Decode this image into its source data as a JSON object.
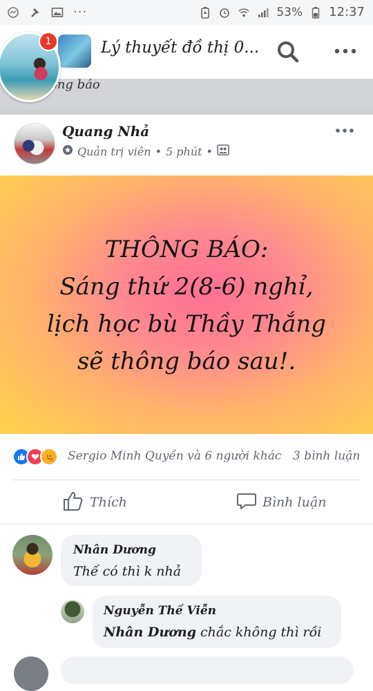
{
  "status_bar": {
    "battery": "53%",
    "time": "12:37",
    "left_icons": [
      "messenger-icon",
      "hammer-icon",
      "image-icon",
      "more-icon"
    ],
    "right_icons": [
      "battery-saver-icon",
      "alarm-icon",
      "wifi-icon",
      "signal-icon",
      "battery-icon"
    ]
  },
  "header": {
    "group_title": "Lý thuyết đồ thị 0...",
    "notification_count": "1",
    "icons": [
      "search-icon",
      "more-horizontal-icon"
    ]
  },
  "notification_strip": {
    "partial_text": "ông báo"
  },
  "post": {
    "author": "Quang Nhả",
    "role": "Quản trị viên",
    "time": "5 phút",
    "separator": "•",
    "text_lines": [
      "THÔNG BÁO:",
      "Sáng thứ 2(8-6) nghỉ,",
      "lịch học bù Thầy Thắng",
      "sẽ thông báo sau!."
    ],
    "background_colors": [
      "#ff6f93",
      "#ffb36b",
      "#ffd34a"
    ],
    "reactions": {
      "icons": [
        "like-icon",
        "love-icon",
        "care-icon"
      ],
      "names": "Sergio Minh Quyền và 6 người khác",
      "comment_count": "3 bình luận"
    },
    "actions": {
      "like_label": "Thích",
      "comment_label": "Bình luận"
    }
  },
  "comments": [
    {
      "name": "Nhân Dương",
      "text": "Thế có thì k nhả"
    },
    {
      "name": "Nguyễn Thế Viễn",
      "mention": "Nhân Dương",
      "text": "chắc không thì rồi"
    }
  ],
  "colors": {
    "like_blue": "#1877f2",
    "love_red": "#f33e58",
    "care_yellow": "#f7b125",
    "badge_red": "#e8372c"
  }
}
